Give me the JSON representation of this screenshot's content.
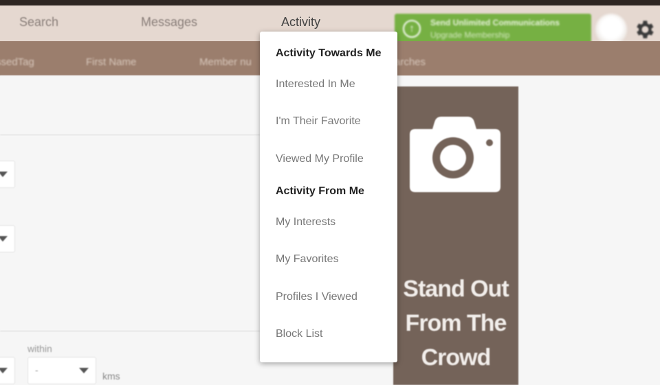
{
  "navbar": {
    "items": [
      {
        "label": "Search"
      },
      {
        "label": "Messages"
      },
      {
        "label": "Activity",
        "active": true
      }
    ],
    "upgrade": {
      "title": "Send Unlimited Communications",
      "subtitle": "Upgrade Membership",
      "icon": "arrow-up-circle-icon",
      "color": "#76b043"
    },
    "avatar_icon": "avatar",
    "settings_icon": "gear-icon"
  },
  "subbar": {
    "items": [
      {
        "label": "ssedTag"
      },
      {
        "label": "First Name"
      },
      {
        "label": "Member nu"
      },
      {
        "label": "arches"
      }
    ]
  },
  "form": {
    "within_label": "within",
    "within_value": "-",
    "distance_unit": "kms"
  },
  "promo": {
    "icon": "camera-icon",
    "text_lines": [
      "Stand Out",
      "From The",
      "Crowd"
    ],
    "color": "#746359"
  },
  "activity_menu": {
    "sections": [
      {
        "heading": "Activity Towards Me",
        "items": [
          "Interested In Me",
          "I'm Their Favorite",
          "Viewed My Profile"
        ]
      },
      {
        "heading": "Activity From Me",
        "items": [
          "My Interests",
          "My Favorites",
          "Profiles I Viewed",
          "Block List"
        ]
      }
    ]
  },
  "colors": {
    "navbar_bg": "#e5d8d0",
    "subbar_bg": "#9b7e6d",
    "top_strip": "#2e2622"
  }
}
